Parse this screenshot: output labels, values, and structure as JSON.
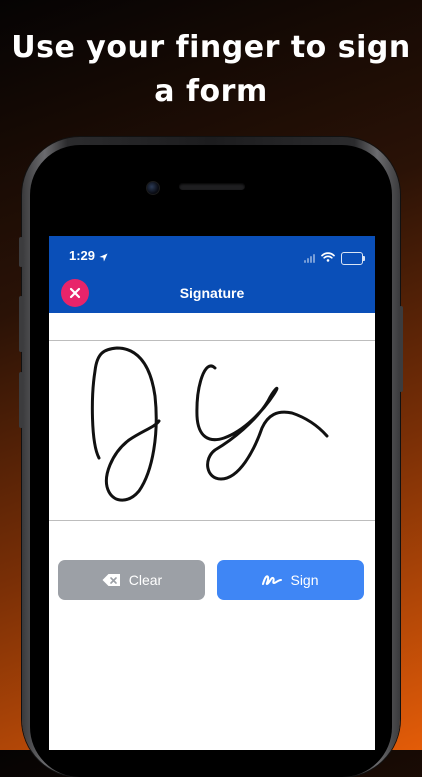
{
  "headline": {
    "line1": "Use your finger to sign",
    "line2": "a form"
  },
  "status_bar": {
    "time": "1:29"
  },
  "header": {
    "title": "Signature"
  },
  "buttons": {
    "clear_label": "Clear",
    "sign_label": "Sign"
  },
  "icons": {
    "close": "close-icon",
    "clear": "eraser-icon",
    "sign": "signature-icon",
    "location": "location-arrow-icon",
    "signal": "cellular-signal-icon",
    "wifi": "wifi-icon",
    "battery": "battery-icon"
  },
  "colors": {
    "header_bg": "#0a4fb8",
    "close_button": "#e8246a",
    "clear_button": "#9ca0a6",
    "sign_button": "#3f86f5",
    "ink": "#111111"
  }
}
